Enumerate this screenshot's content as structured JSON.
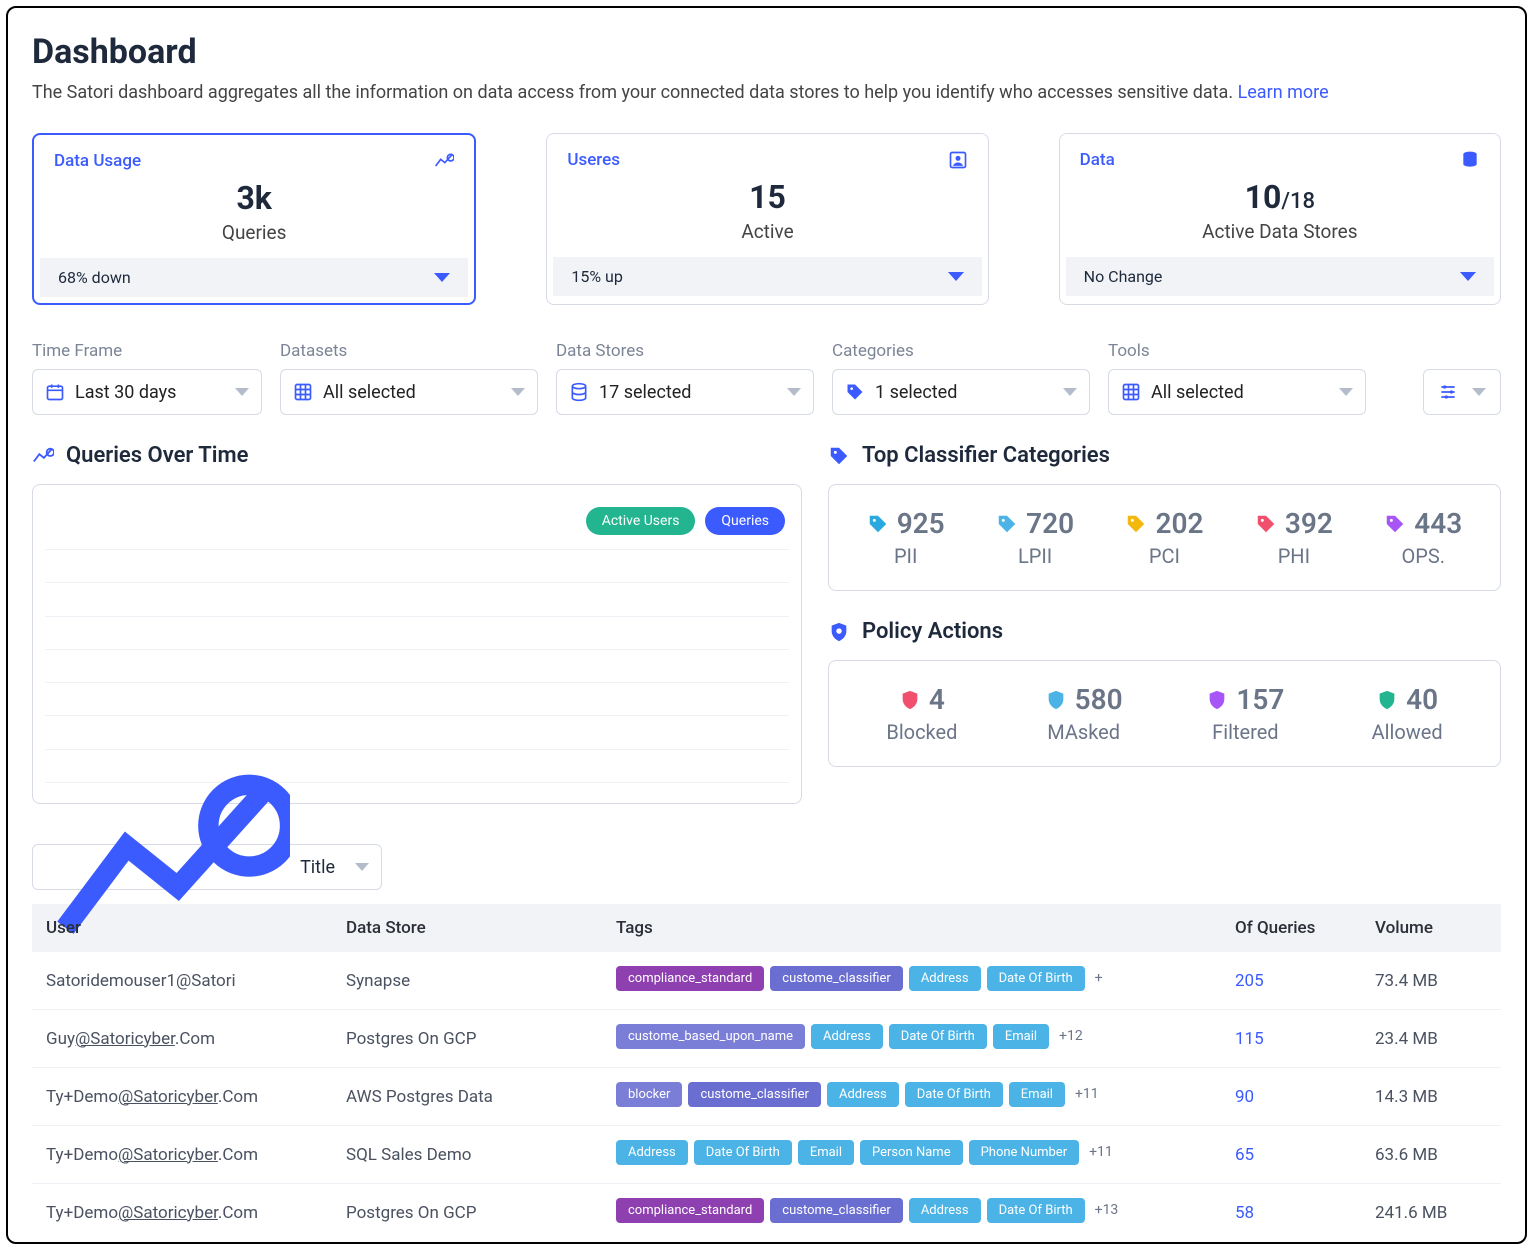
{
  "header": {
    "title": "Dashboard",
    "subtitle": "The Satori dashboard aggregates all the information on data access from your connected data stores to help you identify who accesses sensitive data.",
    "learn_more": "Learn more"
  },
  "kpi": {
    "usage": {
      "label": "Data Usage",
      "value": "3k",
      "sub": "Queries",
      "change": "68% down"
    },
    "users": {
      "label": "Useres",
      "value": "15",
      "sub": "Active",
      "change": "15% up"
    },
    "data": {
      "label": "Data",
      "value": "10",
      "denom": "/18",
      "sub": "Active Data Stores",
      "change": "No Change"
    }
  },
  "filters": {
    "time": {
      "label": "Time Frame",
      "value": "Last 30 days"
    },
    "datasets": {
      "label": "Datasets",
      "value": "All selected"
    },
    "datastores": {
      "label": "Data Stores",
      "value": "17 selected"
    },
    "categories": {
      "label": "Categories",
      "value": "1 selected"
    },
    "tools": {
      "label": "Tools",
      "value": "All selected"
    }
  },
  "queries_over_time": {
    "title": "Queries Over Time",
    "legend": {
      "active": "Active Users",
      "queries": "Queries"
    }
  },
  "top_classifiers": {
    "title": "Top Classifier Categories",
    "items": [
      {
        "value": "925",
        "label": "PII",
        "color": "#2aa8e0"
      },
      {
        "value": "720",
        "label": "LPII",
        "color": "#4bb3e6"
      },
      {
        "value": "202",
        "label": "PCI",
        "color": "#f2b90c"
      },
      {
        "value": "392",
        "label": "PHI",
        "color": "#f0506e"
      },
      {
        "value": "443",
        "label": "OPS.",
        "color": "#a855f7"
      }
    ]
  },
  "policy_actions": {
    "title": "Policy Actions",
    "items": [
      {
        "value": "4",
        "label": "Blocked",
        "color": "#f0506e"
      },
      {
        "value": "580",
        "label": "MAsked",
        "color": "#4bb3e6"
      },
      {
        "value": "157",
        "label": "Filtered",
        "color": "#a855f7"
      },
      {
        "value": "40",
        "label": "Allowed",
        "color": "#22b58f"
      }
    ]
  },
  "table": {
    "title_selector": "Title",
    "columns": {
      "user": "User",
      "datastore": "Data Store",
      "tags": "Tags",
      "queries": "Of Queries",
      "volume": "Volume"
    },
    "rows": [
      {
        "user_parts": [
          "Satoridemouser1@Satori"
        ],
        "datastore": "Synapse",
        "tags": [
          {
            "text": "compliance_standard",
            "cls": "tg-purple"
          },
          {
            "text": "custome_classifier",
            "cls": "tg-violet"
          },
          {
            "text": "Address",
            "cls": "tg-sky"
          },
          {
            "text": "Date Of Birth",
            "cls": "tg-sky"
          }
        ],
        "more": "+",
        "queries": "205",
        "volume": "73.4 MB"
      },
      {
        "user_parts": [
          "Guy",
          "@Satoricyber",
          ".Com"
        ],
        "datastore": "Postgres On GCP",
        "tags": [
          {
            "text": "custome_based_upon_name",
            "cls": "tg-lavender"
          },
          {
            "text": "Address",
            "cls": "tg-sky"
          },
          {
            "text": "Date Of Birth",
            "cls": "tg-sky"
          },
          {
            "text": "Email",
            "cls": "tg-sky"
          }
        ],
        "more": "+12",
        "queries": "115",
        "volume": "23.4 MB"
      },
      {
        "user_parts": [
          "Ty+Demo",
          "@Satoricyber",
          ".Com"
        ],
        "datastore": "AWS Postgres Data",
        "tags": [
          {
            "text": "blocker",
            "cls": "tg-lavender"
          },
          {
            "text": "custome_classifier",
            "cls": "tg-violet"
          },
          {
            "text": "Address",
            "cls": "tg-sky"
          },
          {
            "text": "Date Of Birth",
            "cls": "tg-sky"
          },
          {
            "text": "Email",
            "cls": "tg-sky"
          }
        ],
        "more": "+11",
        "queries": "90",
        "volume": "14.3 MB"
      },
      {
        "user_parts": [
          "Ty+Demo",
          "@Satoricyber",
          ".Com"
        ],
        "datastore": "SQL Sales Demo",
        "tags": [
          {
            "text": "Address",
            "cls": "tg-sky"
          },
          {
            "text": "Date Of Birth",
            "cls": "tg-sky"
          },
          {
            "text": "Email",
            "cls": "tg-sky"
          },
          {
            "text": "Person Name",
            "cls": "tg-sky"
          },
          {
            "text": "Phone Number",
            "cls": "tg-sky"
          }
        ],
        "more": "+11",
        "queries": "65",
        "volume": "63.6 MB"
      },
      {
        "user_parts": [
          "Ty+Demo",
          "@Satoricyber",
          ".Com"
        ],
        "datastore": "Postgres On GCP",
        "tags": [
          {
            "text": "compliance_standard",
            "cls": "tg-purple"
          },
          {
            "text": "custome_classifier",
            "cls": "tg-violet"
          },
          {
            "text": "Address",
            "cls": "tg-sky"
          },
          {
            "text": "Date Of Birth",
            "cls": "tg-sky"
          }
        ],
        "more": "+13",
        "queries": "58",
        "volume": "241.6 MB"
      }
    ]
  },
  "chart_data": {
    "type": "line",
    "title": "Queries Over Time",
    "series": [
      {
        "name": "Active Users",
        "values": []
      },
      {
        "name": "Queries",
        "values": []
      }
    ],
    "x": [],
    "note": "chart body renders no visible data points in the screenshot"
  }
}
